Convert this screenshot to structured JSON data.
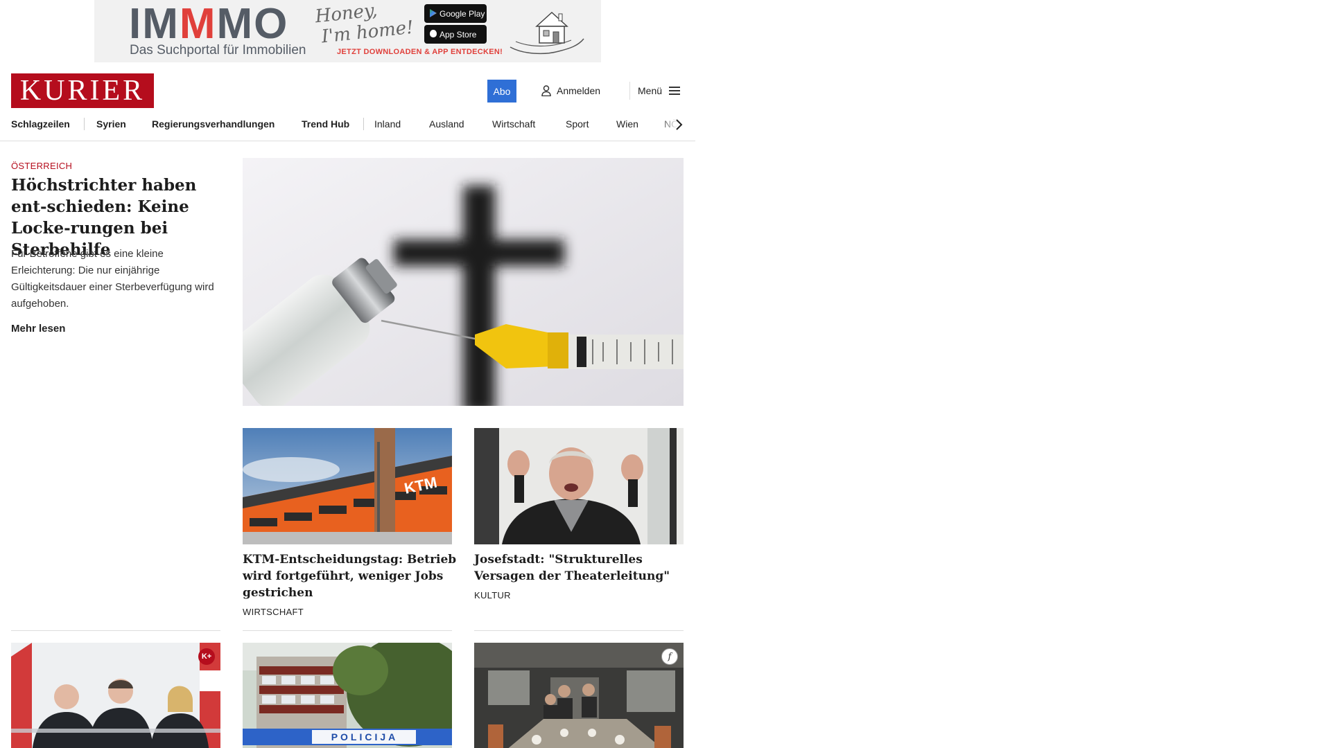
{
  "ad": {
    "brand_prefix": "IM",
    "brand_m": "M",
    "brand_suffix": "MO",
    "subtitle": "Das Suchportal für Immobilien",
    "script_line1": "Honey,",
    "script_line2": "I'm home!",
    "google_play": "Google Play",
    "app_store": "App Store",
    "cta": "JETZT DOWNLOADEN & APP ENTDECKEN!"
  },
  "header": {
    "logo": "KURIER",
    "abo": "Abo",
    "login": "Anmelden",
    "menu": "Menü"
  },
  "nav": {
    "items": [
      "Schlagzeilen",
      "Syrien",
      "Regierungsverhandlungen",
      "Trend Hub",
      "Inland",
      "Ausland",
      "Wirtschaft",
      "Sport",
      "Wien",
      "NÖ"
    ]
  },
  "lead": {
    "kicker": "ÖSTERREICH",
    "title": "Höchstrichter haben ent-schieden: Keine Locke-rungen bei Sterbehilfe",
    "text": "Für Betroffene gibt es eine kleine Erleichterung: Die nur einjährige Gültigkeitsdauer einer Sterbeverfügung wird aufgehoben.",
    "more": "Mehr lesen"
  },
  "teasers": [
    {
      "title": "KTM-Entscheidungstag: Betrieb wird fortgeführt, weniger Jobs gestrichen",
      "category": "WIRTSCHAFT"
    },
    {
      "title": "Josefstadt: \"Strukturelles Versagen der Theaterleitung\"",
      "category": "KULTUR"
    }
  ],
  "bottom": {
    "kplus": "K+",
    "police_sign": "POLICIJA",
    "f_badge": "f"
  },
  "colors": {
    "brand_red": "#b50d1d",
    "abo_blue": "#2f6fd6"
  }
}
